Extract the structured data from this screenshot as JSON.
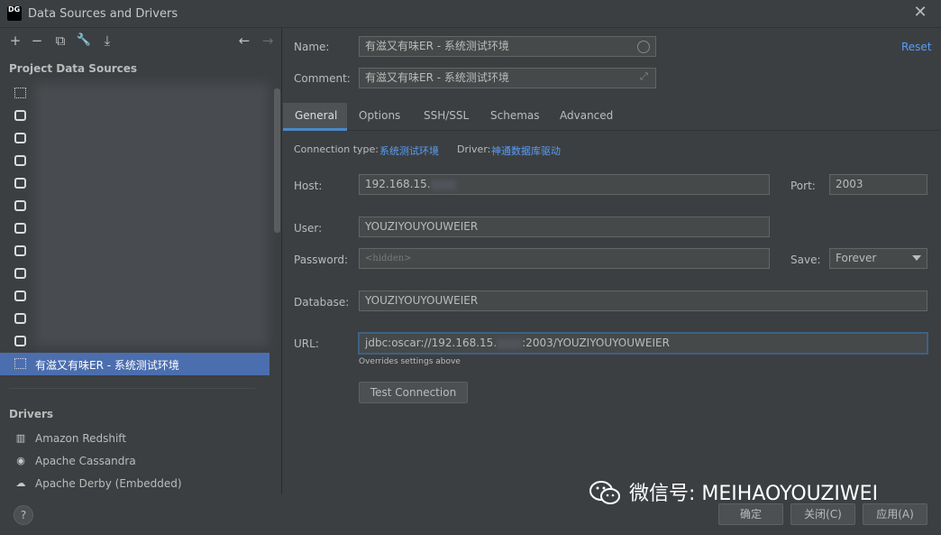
{
  "window": {
    "title": "Data Sources and Drivers",
    "logo_top": "DG",
    "logo_bottom": "",
    "close_glyph": "✕"
  },
  "toolbar": {
    "add_icon": "+",
    "remove_icon": "−",
    "copy_icon": "⧉",
    "properties_icon": "🔧",
    "import_icon": "⤓",
    "back_icon": "←",
    "forward_icon": "→"
  },
  "sidebar": {
    "project_header": "Project Data Sources",
    "selected_item": "有滋又有味ER - 系统测试环境",
    "drivers_header": "Drivers",
    "drivers": [
      {
        "label": "Amazon Redshift",
        "icon": "redshift-icon"
      },
      {
        "label": "Apache Cassandra",
        "icon": "cassandra-icon"
      },
      {
        "label": "Apache Derby (Embedded)",
        "icon": "derby-icon"
      }
    ]
  },
  "form": {
    "name_label": "Name:",
    "name_value": "有滋又有味ER - 系统测试环境",
    "comment_label": "Comment:",
    "comment_value": "有滋又有味ER - 系统测试环境",
    "reset_label": "Reset",
    "tabs": [
      "General",
      "Options",
      "SSH/SSL",
      "Schemas",
      "Advanced"
    ],
    "active_tab": "General",
    "connection_type_label": "Connection type:",
    "connection_type_value": "系统测试环境",
    "driver_label": "Driver:",
    "driver_value": "神通数据库驱动",
    "host_label": "Host:",
    "host_value": "192.168.15.",
    "port_label": "Port:",
    "port_value": "2003",
    "user_label": "User:",
    "user_value": "YOUZIYOUYOUWEIER",
    "password_label": "Password:",
    "password_placeholder": "<hidden>",
    "save_label": "Save:",
    "save_value": "Forever",
    "database_label": "Database:",
    "database_value": "YOUZIYOUYOUWEIER",
    "url_label": "URL:",
    "url_prefix": "jdbc:oscar://192.168.15.",
    "url_suffix": ":2003/YOUZIYOUYOUWEIER",
    "overrides_note": "Overrides settings above",
    "test_connection_label": "Test Connection"
  },
  "footer": {
    "help_label": "?",
    "ok_label": "确定",
    "close_label": "关闭(C)",
    "apply_label": "应用(A)"
  },
  "watermark": {
    "text": "微信号: MEIHAOYOUZIWEI"
  },
  "colors": {
    "background": "#3c3f41",
    "selection": "#4b6eaf",
    "link": "#589df6",
    "focus_border": "#3d6185"
  }
}
